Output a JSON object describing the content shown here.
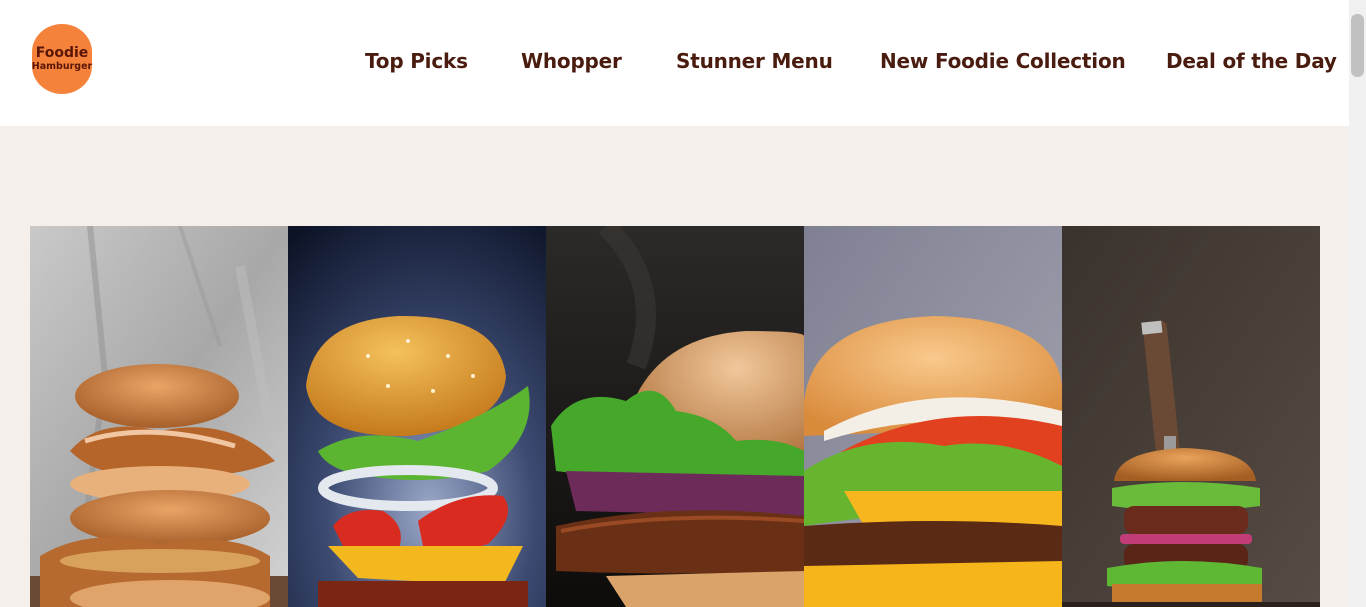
{
  "brand": {
    "line1": "Foodie",
    "line2": "Hamburger"
  },
  "nav": [
    {
      "label": "Top Picks"
    },
    {
      "label": "Whopper"
    },
    {
      "label": "Stunner Menu"
    },
    {
      "label": "New Foodie Collection"
    },
    {
      "label": "Deal of the Day"
    }
  ],
  "colors": {
    "brand_orange": "#f5823a",
    "brand_text": "#5a1608",
    "nav_text": "#4a1c10",
    "page_bg": "#f4efea",
    "header_bg": "#ffffff"
  },
  "gallery": [
    {
      "name": "stacked-chicken-burger-photo"
    },
    {
      "name": "floating-burger-photo"
    },
    {
      "name": "closeup-burger-photo"
    },
    {
      "name": "cheeseburger-photo"
    },
    {
      "name": "burger-with-knife-photo"
    }
  ]
}
